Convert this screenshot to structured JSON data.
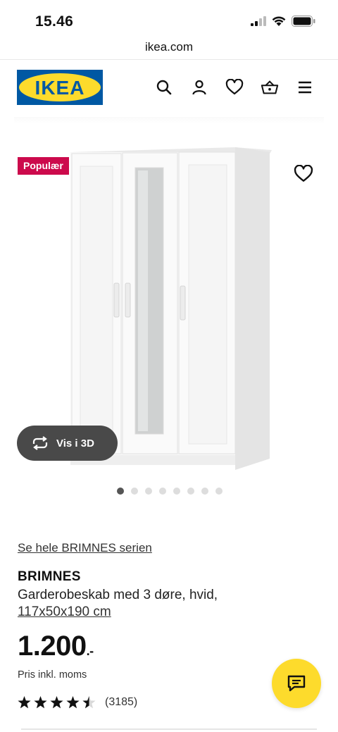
{
  "status_bar": {
    "time": "15.46"
  },
  "browser": {
    "url": "ikea.com"
  },
  "header": {
    "logo_text": "IKEA",
    "icons": [
      "search-icon",
      "account-icon",
      "favourites-icon",
      "basket-icon",
      "menu-icon"
    ]
  },
  "gallery": {
    "badge": "Populær",
    "view_3d_label": "Vis i 3D",
    "image_count": 8,
    "active_index": 0
  },
  "product": {
    "series_link": "Se hele BRIMNES serien",
    "name": "BRIMNES",
    "description": "Garderobeskab med 3 døre, hvid,",
    "size": "117x50x190 cm",
    "price": "1.200",
    "price_suffix": ".-",
    "price_note": "Pris inkl. moms",
    "rating": 4.5,
    "review_count": "(3185)"
  },
  "colors": {
    "ikea_blue": "#0058a3",
    "ikea_yellow": "#fddb2c",
    "badge_red": "#cc0a4c",
    "view3d_bg": "#494949"
  }
}
